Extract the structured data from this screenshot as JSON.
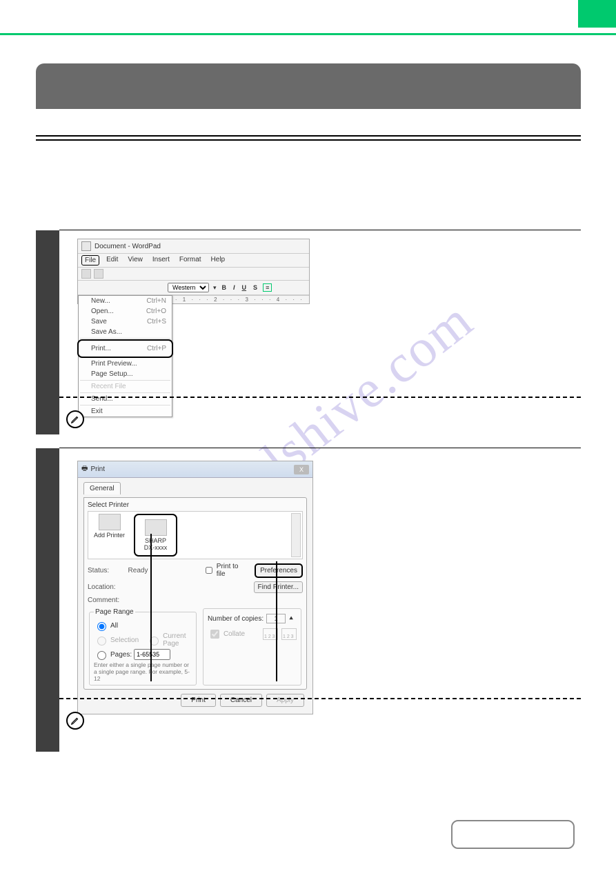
{
  "watermark": "manualshive.com",
  "wordpad": {
    "window_title": "Document - WordPad",
    "menubar": {
      "file": "File",
      "edit": "Edit",
      "view": "View",
      "insert": "Insert",
      "format": "Format",
      "help": "Help"
    },
    "toolbar2": {
      "font_script": "Western",
      "b": "B",
      "i": "I",
      "u": "U",
      "s": "S"
    },
    "ruler": "· · 1 · · · 2 · · · 3 · · · 4 · · ·",
    "file_menu": {
      "new": "New...",
      "new_sc": "Ctrl+N",
      "open": "Open...",
      "open_sc": "Ctrl+O",
      "save": "Save",
      "save_sc": "Ctrl+S",
      "save_as": "Save As...",
      "print": "Print...",
      "print_sc": "Ctrl+P",
      "print_preview": "Print Preview...",
      "page_setup": "Page Setup...",
      "recent": "Recent File",
      "send": "Send...",
      "exit": "Exit"
    }
  },
  "printdlg": {
    "title": "Print",
    "close_x": "X",
    "tab_general": "General",
    "select_printer_label": "Select Printer",
    "printers": {
      "add": "Add Printer",
      "sharp": "SHARP",
      "sharp_model": "DX-xxxx"
    },
    "status_label": "Status:",
    "status_value": "Ready",
    "location_label": "Location:",
    "comment_label": "Comment:",
    "print_to_file": "Print to file",
    "preferences_btn": "Preferences",
    "find_printer_btn": "Find Printer...",
    "page_range": {
      "legend": "Page Range",
      "all": "All",
      "selection": "Selection",
      "current_page": "Current Page",
      "pages": "Pages:",
      "pages_value": "1-65535",
      "note": "Enter either a single page number or a single page range.  For example, 5-12"
    },
    "copies": {
      "num_label": "Number of copies:",
      "num_value": "1",
      "collate": "Collate",
      "icon_text": "1 2 3"
    },
    "buttons": {
      "print": "Print",
      "cancel": "Cancel",
      "apply": "Apply"
    }
  }
}
